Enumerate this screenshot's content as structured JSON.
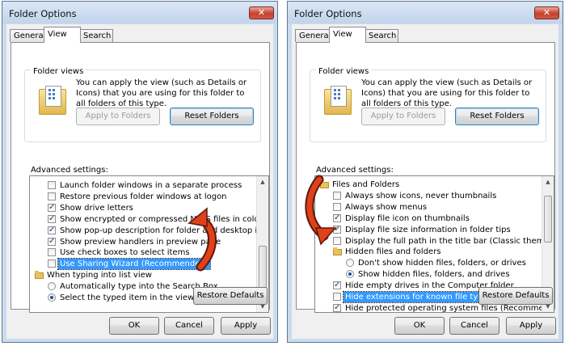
{
  "dialogs": [
    {
      "title": "Folder Options",
      "tabs": [
        "General",
        "View",
        "Search"
      ],
      "active_tab": "View",
      "folder_views": {
        "label": "Folder views",
        "text": "You can apply the view (such as Details or Icons) that you are using for this folder to all folders of this type.",
        "apply_button": "Apply to Folders",
        "reset_button": "Reset Folders"
      },
      "advanced_label": "Advanced settings:",
      "items": [
        {
          "kind": "checkbox",
          "checked": false,
          "indent": 1,
          "label": "Launch folder windows in a separate process"
        },
        {
          "kind": "checkbox",
          "checked": false,
          "indent": 1,
          "label": "Restore previous folder windows at logon"
        },
        {
          "kind": "checkbox",
          "checked": true,
          "indent": 1,
          "label": "Show drive letters"
        },
        {
          "kind": "checkbox",
          "checked": true,
          "indent": 1,
          "label": "Show encrypted or compressed NTFS files in color"
        },
        {
          "kind": "checkbox",
          "checked": true,
          "indent": 1,
          "label": "Show pop-up description for folder and desktop items"
        },
        {
          "kind": "checkbox",
          "checked": true,
          "indent": 1,
          "label": "Show preview handlers in preview pane"
        },
        {
          "kind": "checkbox",
          "checked": false,
          "indent": 1,
          "label": "Use check boxes to select items"
        },
        {
          "kind": "checkbox",
          "checked": false,
          "indent": 1,
          "selected": true,
          "label": "Use Sharing Wizard (Recommended)"
        },
        {
          "kind": "folder",
          "indent": 0,
          "label": "When typing into list view"
        },
        {
          "kind": "radio",
          "checked": false,
          "indent": 1,
          "label": "Automatically type into the Search Box"
        },
        {
          "kind": "radio",
          "checked": true,
          "indent": 1,
          "label": "Select the typed item in the view"
        }
      ],
      "scroll_fraction": 0.9,
      "restore_button": "Restore Defaults",
      "ok_button": "OK",
      "cancel_button": "Cancel",
      "apply_button": "Apply"
    },
    {
      "title": "Folder Options",
      "tabs": [
        "General",
        "View",
        "Search"
      ],
      "active_tab": "View",
      "folder_views": {
        "label": "Folder views",
        "text": "You can apply the view (such as Details or Icons) that you are using for this folder to all folders of this type.",
        "apply_button": "Apply to Folders",
        "reset_button": "Reset Folders"
      },
      "advanced_label": "Advanced settings:",
      "items": [
        {
          "kind": "folder",
          "indent": 0,
          "label": "Files and Folders"
        },
        {
          "kind": "checkbox",
          "checked": false,
          "indent": 1,
          "label": "Always show icons, never thumbnails"
        },
        {
          "kind": "checkbox",
          "checked": false,
          "indent": 1,
          "label": "Always show menus"
        },
        {
          "kind": "checkbox",
          "checked": true,
          "indent": 1,
          "label": "Display file icon on thumbnails"
        },
        {
          "kind": "checkbox",
          "checked": true,
          "indent": 1,
          "label": "Display file size information in folder tips"
        },
        {
          "kind": "checkbox",
          "checked": false,
          "indent": 1,
          "label": "Display the full path in the title bar (Classic theme only)"
        },
        {
          "kind": "folder",
          "indent": 1,
          "label": "Hidden files and folders"
        },
        {
          "kind": "radio",
          "checked": false,
          "indent": 2,
          "label": "Don't show hidden files, folders, or drives"
        },
        {
          "kind": "radio",
          "checked": true,
          "indent": 2,
          "label": "Show hidden files, folders, and drives"
        },
        {
          "kind": "checkbox",
          "checked": true,
          "indent": 1,
          "label": "Hide empty drives in the Computer folder"
        },
        {
          "kind": "checkbox",
          "checked": false,
          "indent": 1,
          "selected": true,
          "label": "Hide extensions for known file types"
        },
        {
          "kind": "checkbox",
          "checked": true,
          "indent": 1,
          "label": "Hide protected operating system files (Recommended)"
        }
      ],
      "scroll_fraction": 0.1,
      "restore_button": "Restore Defaults",
      "ok_button": "OK",
      "cancel_button": "Cancel",
      "apply_button": "Apply"
    }
  ],
  "icons": {
    "close": "close-icon",
    "folder_views": "folder-views-icon",
    "arrow": "red-curved-arrow-icon"
  },
  "colors": {
    "selection": "#3399ff",
    "arrow": "#e0401a",
    "dialog_frame": "#cbdbee"
  }
}
